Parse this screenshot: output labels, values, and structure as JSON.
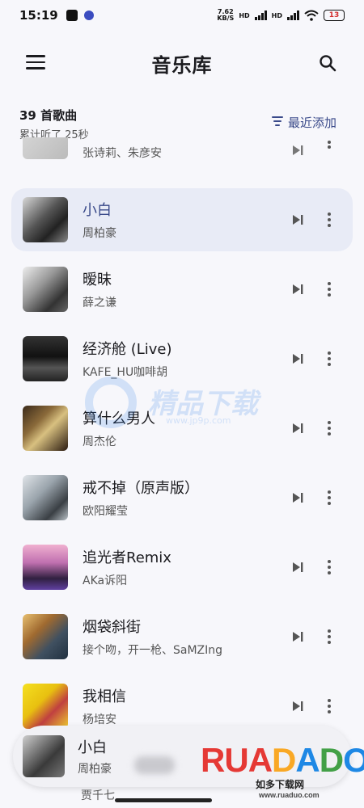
{
  "status_bar": {
    "time": "15:19",
    "net_speed_top": "7.62",
    "net_speed_bottom": "KB/S",
    "hd1": "HD",
    "hd2": "HD",
    "battery": "13"
  },
  "app_bar": {
    "title": "音乐库",
    "menu_icon": "hamburger-menu-icon",
    "search_icon": "search-icon"
  },
  "summary": {
    "count": "39 首歌曲",
    "listened": "累计听了 25秒",
    "sort_label": "最近添加",
    "sort_icon": "sort-filter-icon"
  },
  "songs": [
    {
      "title": "",
      "artist": "张诗莉、朱彦安"
    },
    {
      "title": "小白",
      "artist": "周柏豪",
      "active": true
    },
    {
      "title": "暧昧",
      "artist": "薛之谦"
    },
    {
      "title": "经济舱 (Live)",
      "artist": "KAFE_HU咖啡胡"
    },
    {
      "title": "算什么男人",
      "artist": "周杰伦"
    },
    {
      "title": "戒不掉（原声版）",
      "artist": "欧阳耀莹"
    },
    {
      "title": "追光者Remix",
      "artist": "AKa诉阳"
    },
    {
      "title": "烟袋斜街",
      "artist": "接个吻，开一枪、SaMZIng"
    },
    {
      "title": "我相信",
      "artist": "杨培安"
    }
  ],
  "mini_player": {
    "title": "小白",
    "artist": "周柏豪",
    "behind_artist": "贾千七"
  },
  "watermark": {
    "logo": "RUANDADO",
    "sub": "如多下载网",
    "url": "www.ruaduo.com",
    "center_text": "精品下载",
    "center_url": "www.jp9p.com"
  },
  "colors": {
    "accent": "#3a4a8a",
    "active_row": "#e8ebf6",
    "background": "#f7f7fb"
  }
}
